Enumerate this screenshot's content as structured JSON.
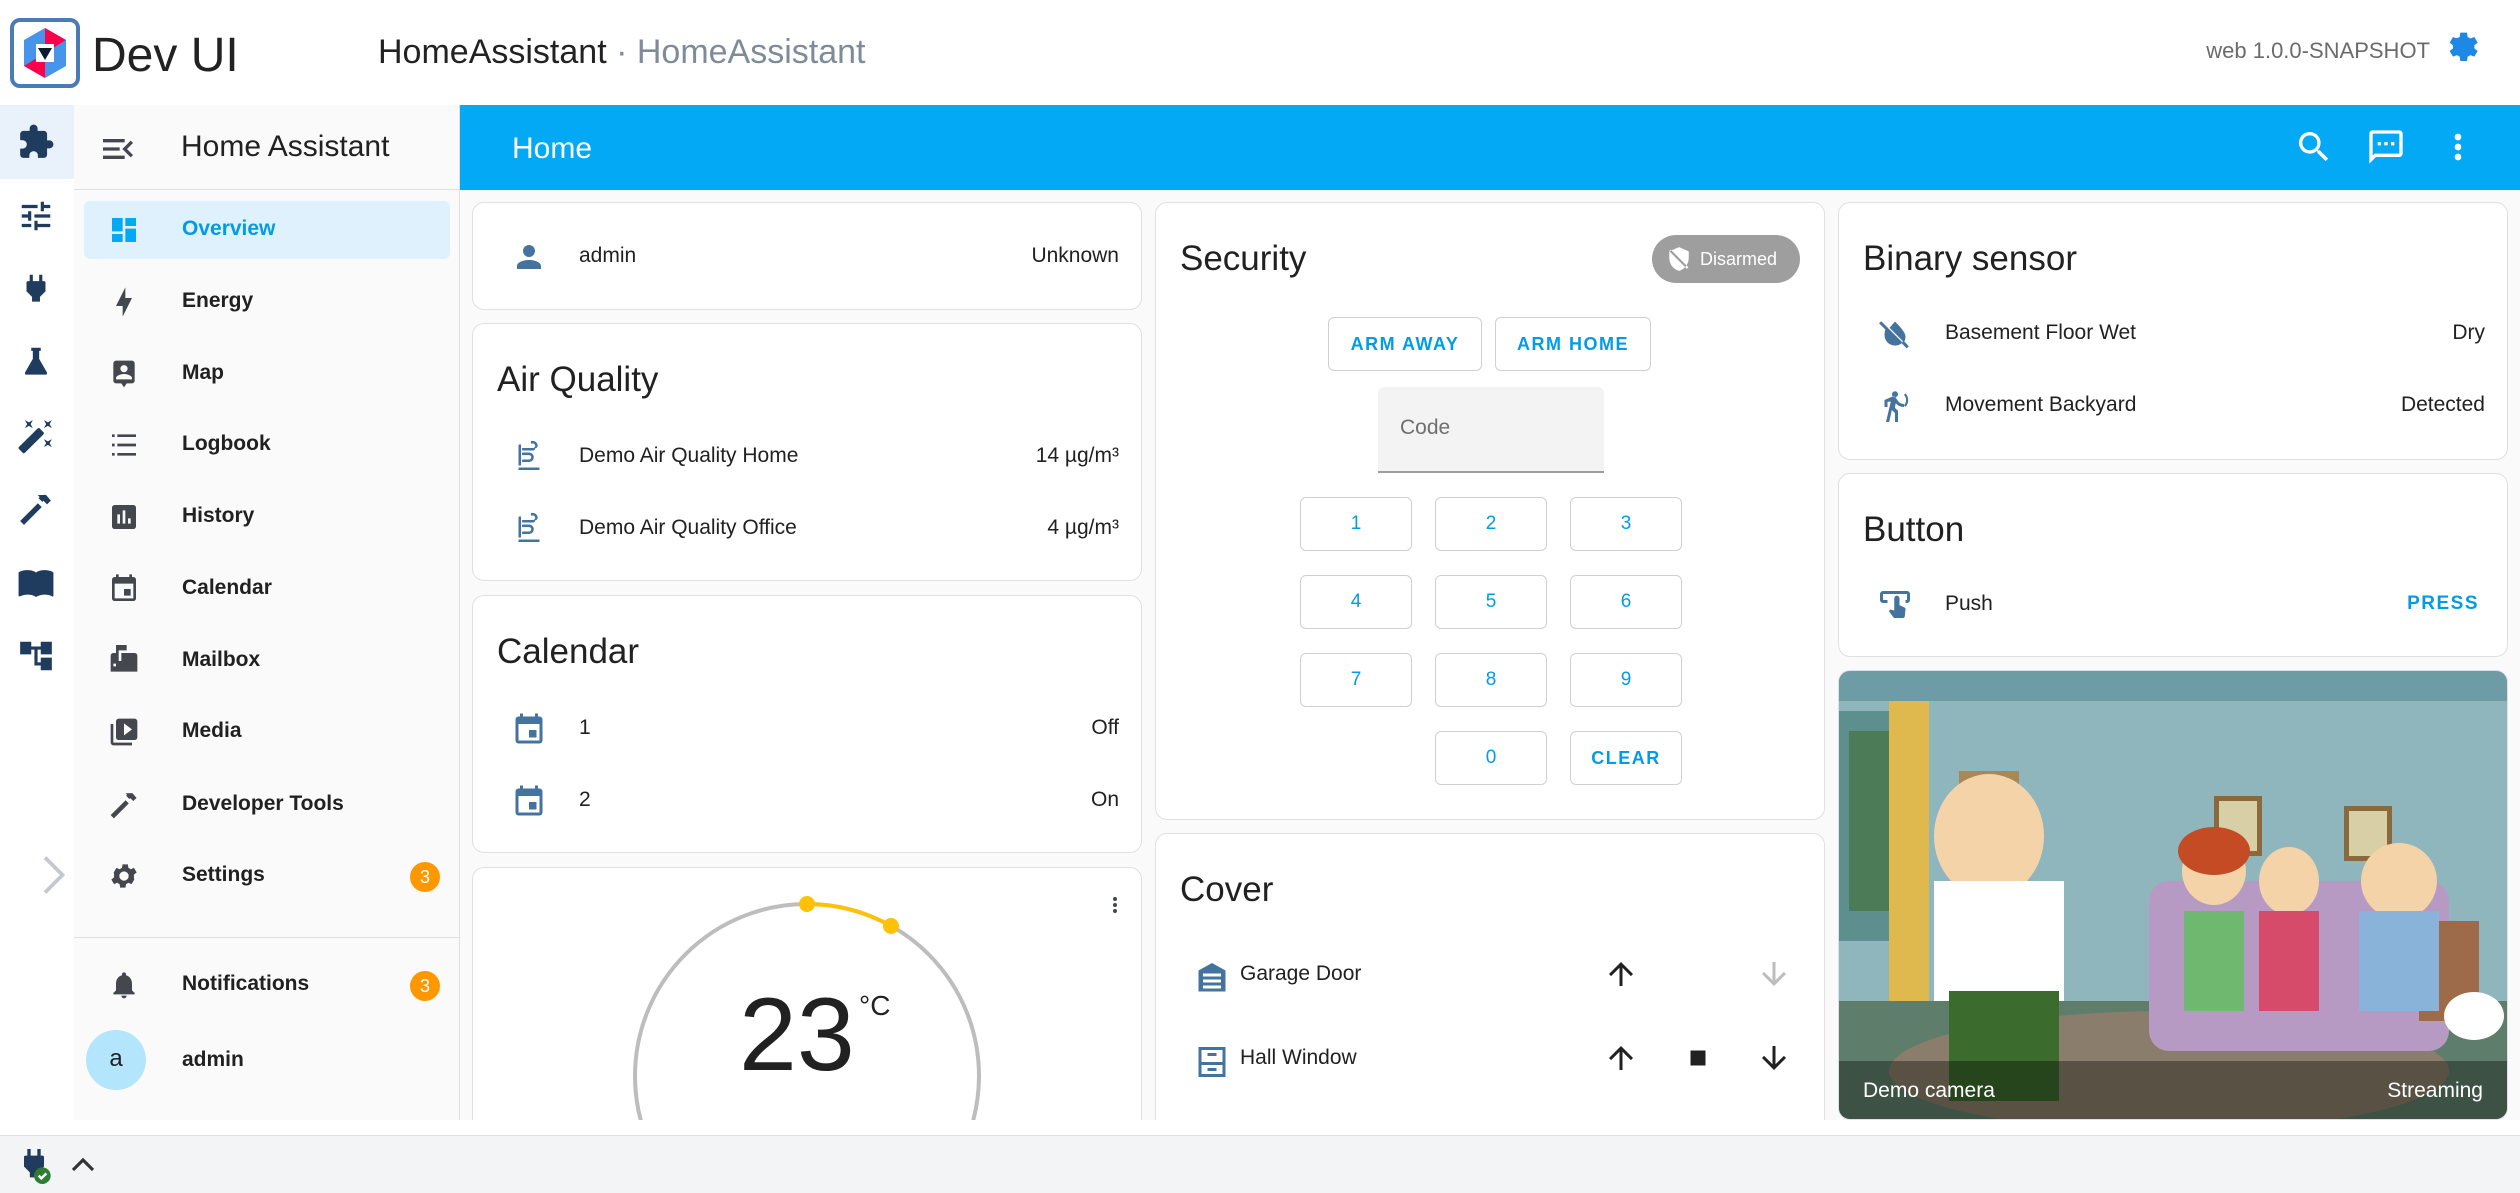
{
  "devui": {
    "title": "Dev UI",
    "crumb_main": "HomeAssistant",
    "crumb_sep": " · ",
    "crumb_sub": "HomeAssistant",
    "version": "web 1.0.0-SNAPSHOT",
    "rail_icons": [
      "extensions-icon",
      "sliders-icon",
      "plug-icon",
      "flask-icon",
      "magic-wand-icon",
      "hammer-icon",
      "book-icon",
      "graph-icon"
    ]
  },
  "sidebar": {
    "title": "Home Assistant",
    "items": [
      {
        "label": "Overview",
        "icon": "dashboard-icon",
        "active": true
      },
      {
        "label": "Energy",
        "icon": "lightning-icon"
      },
      {
        "label": "Map",
        "icon": "map-person-icon"
      },
      {
        "label": "Logbook",
        "icon": "list-icon"
      },
      {
        "label": "History",
        "icon": "chart-box-icon"
      },
      {
        "label": "Calendar",
        "icon": "calendar-icon"
      },
      {
        "label": "Mailbox",
        "icon": "mailbox-icon"
      },
      {
        "label": "Media",
        "icon": "media-icon"
      },
      {
        "label": "Developer Tools",
        "icon": "hammer-icon"
      },
      {
        "label": "Settings",
        "icon": "cog-icon",
        "badge": "3"
      }
    ],
    "notifications": {
      "label": "Notifications",
      "badge": "3"
    },
    "user": {
      "label": "admin",
      "avatar": "a"
    }
  },
  "header": {
    "title": "Home",
    "icons": [
      "search-icon",
      "assist-icon",
      "more-vert-icon"
    ]
  },
  "cards": {
    "person": {
      "name": "admin",
      "state": "Unknown"
    },
    "air_quality": {
      "title": "Air Quality",
      "rows": [
        {
          "name": "Demo Air Quality Home",
          "state": "14 µg/m³"
        },
        {
          "name": "Demo Air Quality Office",
          "state": "4 µg/m³"
        }
      ]
    },
    "calendar": {
      "title": "Calendar",
      "rows": [
        {
          "name": "1",
          "state": "Off"
        },
        {
          "name": "2",
          "state": "On"
        }
      ]
    },
    "thermostat": {
      "value": "23",
      "unit": "°C"
    },
    "security": {
      "title": "Security",
      "status": "Disarmed",
      "arm_away": "ARM AWAY",
      "arm_home": "ARM HOME",
      "code_placeholder": "Code",
      "keys": [
        "1",
        "2",
        "3",
        "4",
        "5",
        "6",
        "7",
        "8",
        "9",
        "0",
        "CLEAR"
      ]
    },
    "cover": {
      "title": "Cover",
      "rows": [
        {
          "name": "Garage Door"
        },
        {
          "name": "Hall Window"
        }
      ]
    },
    "binary_sensor": {
      "title": "Binary sensor",
      "rows": [
        {
          "name": "Basement Floor Wet",
          "state": "Dry"
        },
        {
          "name": "Movement Backyard",
          "state": "Detected"
        }
      ]
    },
    "button": {
      "title": "Button",
      "name": "Push",
      "action": "PRESS"
    },
    "camera": {
      "name": "Demo camera",
      "state": "Streaming"
    }
  },
  "colors": {
    "primary": "#03a9f4",
    "badge": "#ff9800",
    "entity_icon": "#44739e"
  }
}
